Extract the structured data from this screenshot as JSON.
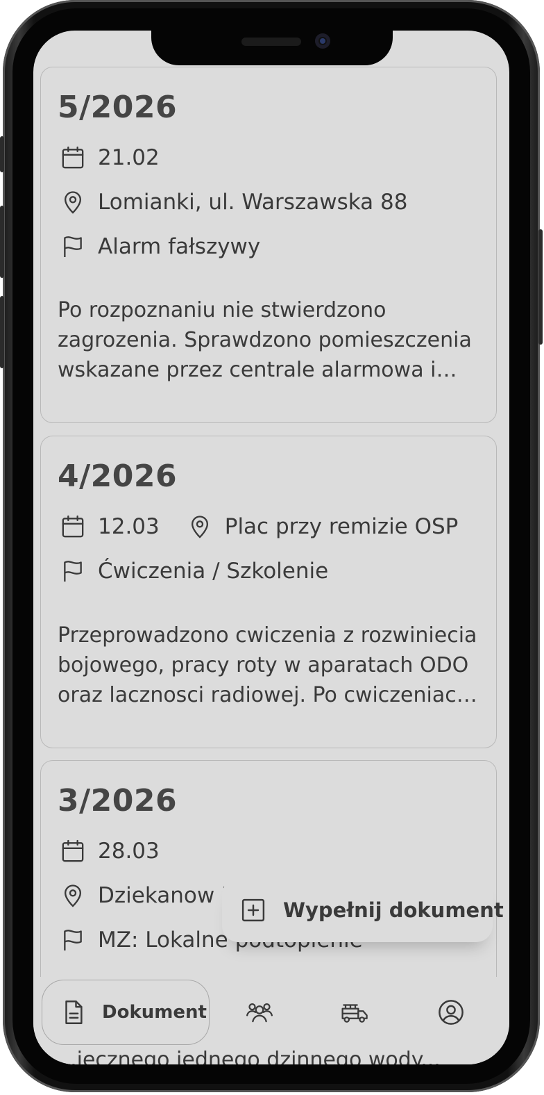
{
  "cards": [
    {
      "title": "5/2026",
      "date": "21.02",
      "location": "Lomianki, ul. Warszawska 88",
      "type": "Alarm fałszywy",
      "description": "Po rozpoznaniu nie stwierdzono zagrozenia. Sprawdzono pomieszczenia wskazane przez centrale alarmowa i…"
    },
    {
      "title": "4/2026",
      "date": "12.03",
      "location": "Plac przy remizie OSP",
      "type": "Ćwiczenia / Szkolenie",
      "description": "Przeprowadzono cwiczenia z rozwiniecia bojowego, pracy roty w aparatach ODO oraz lacznosci radiowej. Po cwiczeniac…"
    },
    {
      "title": "3/2026",
      "date": "28.03",
      "location": "Dziekanow '",
      "type": "MZ: Lokalne podtopienie",
      "description": "...iecznego jednego dzinnego wody..."
    }
  ],
  "fab": {
    "label": "Wypełnij dokument",
    "icon": "plus-square-icon"
  },
  "bottom_nav": [
    {
      "label": "Dokument",
      "icon": "document-icon",
      "active": true
    },
    {
      "label": "",
      "icon": "users-icon",
      "active": false
    },
    {
      "label": "",
      "icon": "fire-truck-icon",
      "active": false
    },
    {
      "label": "",
      "icon": "user-profile-icon",
      "active": false
    }
  ],
  "colors": {
    "screen_bg": "#dcdcdc",
    "card_border": "#b9b9b9",
    "text": "#3a3a3a",
    "title": "#454545"
  }
}
